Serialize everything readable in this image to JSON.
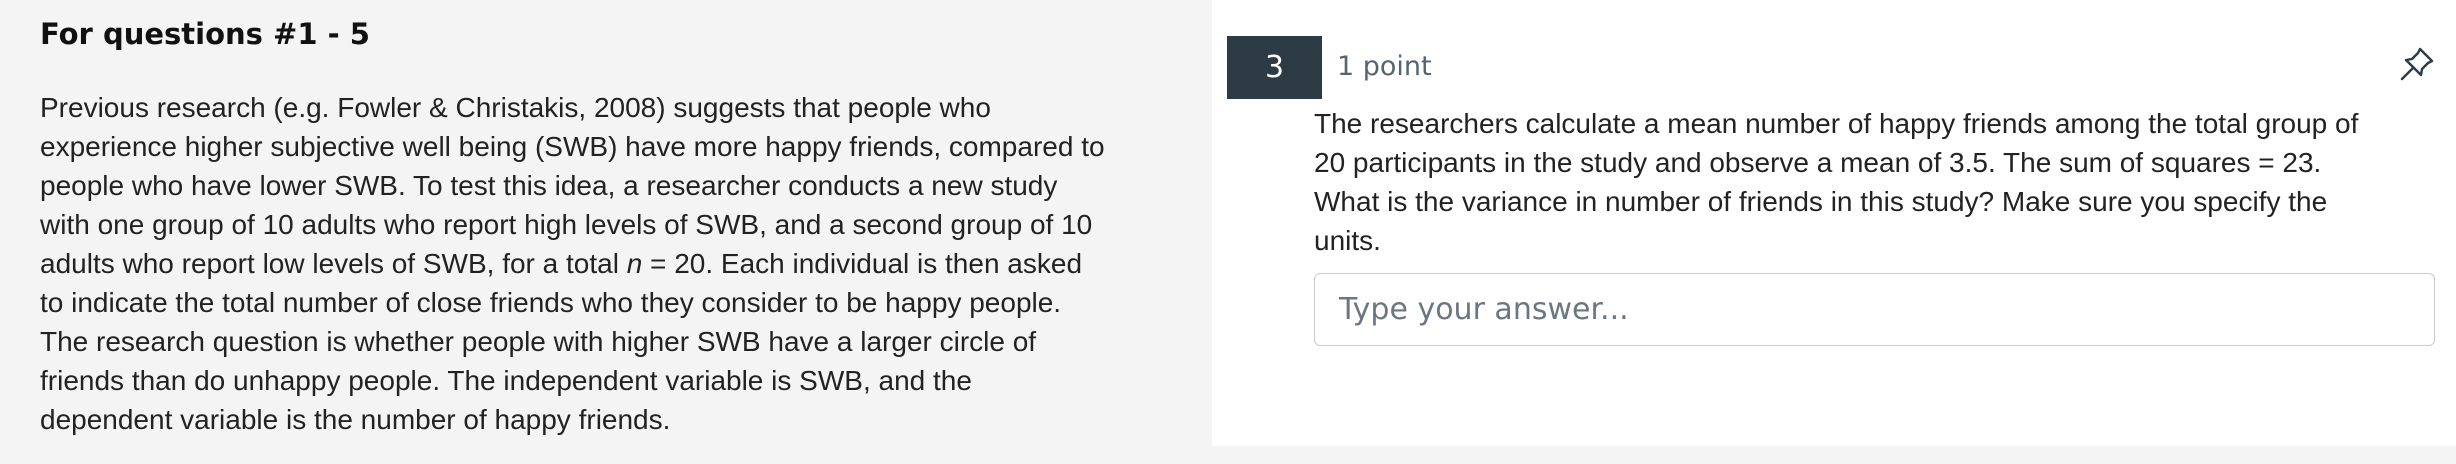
{
  "left": {
    "title": "For questions #1 - 5",
    "passage_lines": [
      "Previous research (e.g. Fowler & Christakis, 2008) suggests that people who",
      "experience higher subjective well being (SWB) have more happy friends, compared to",
      "people who have lower SWB.  To test this idea, a researcher conducts a new study",
      "with one group of 10 adults who report high levels of SWB, and a second group of 10"
    ],
    "line5_before": "adults who report low levels of SWB, for a total ",
    "line5_n": "n",
    "line5_after": " = 20.  Each individual is then asked",
    "passage_lines_rest": [
      "to indicate the total number of close friends who they consider to be happy people.",
      "The research question is whether people with higher SWB have a larger circle of",
      "friends than do unhappy people.  The independent variable is SWB, and the",
      "dependent variable is the number of happy friends."
    ]
  },
  "question": {
    "number": "3",
    "points": "1 point",
    "pin_icon": "pin-icon",
    "text_lines": [
      "The researchers calculate a mean number of happy friends among the total group of",
      "20 participants in the study and observe a mean of 3.5. The sum of squares = 23.",
      "What is the variance in number of friends in this study? Make sure you specify the",
      "units."
    ],
    "answer_placeholder": "Type your answer...",
    "answer_value": ""
  },
  "colors": {
    "left_background": "#f4f4f4",
    "question_badge": "#2d3b45",
    "answer_border": "#c7cdd1"
  }
}
